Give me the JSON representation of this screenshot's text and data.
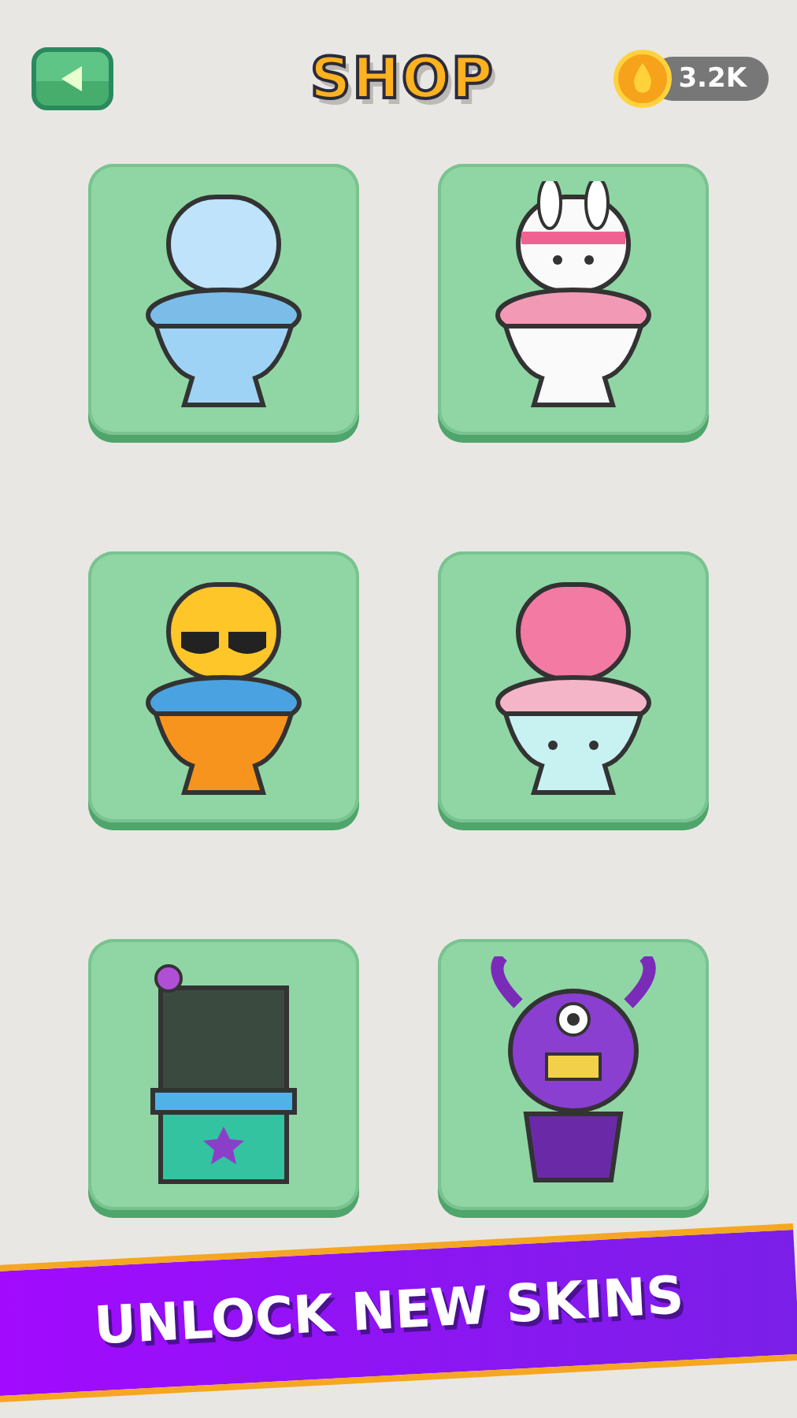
{
  "header": {
    "title": "SHOP",
    "coins": "3.2K"
  },
  "items": [
    {
      "kind": "plain"
    },
    {
      "kind": "bunny"
    },
    {
      "kind": "sunglasses"
    },
    {
      "kind": "pink"
    },
    {
      "kind": "box"
    },
    {
      "kind": "monster"
    }
  ],
  "banner": {
    "text": "UNLOCK NEW SKINS"
  }
}
